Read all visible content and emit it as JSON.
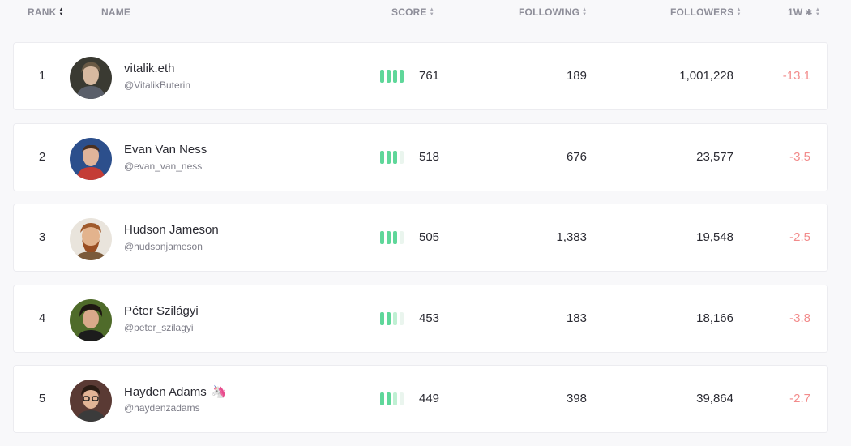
{
  "header": {
    "rank": "RANK",
    "name": "NAME",
    "score": "SCORE",
    "following": "FOLLOWING",
    "followers": "FOLLOWERS",
    "week": "1W",
    "star_glyph": "✱"
  },
  "colors": {
    "score_bar_on": "#5fd79a",
    "score_bar_off": "#eaf5ee",
    "negative_change": "#f28b8b"
  },
  "rows": [
    {
      "rank": "1",
      "name": "vitalik.eth",
      "handle": "@VitalikButerin",
      "score": "761",
      "score_level": 4,
      "following": "189",
      "followers": "1,001,228",
      "change": "-13.1",
      "emoji": ""
    },
    {
      "rank": "2",
      "name": "Evan Van Ness",
      "handle": "@evan_van_ness",
      "score": "518",
      "score_level": 3,
      "following": "676",
      "followers": "23,577",
      "change": "-3.5",
      "emoji": ""
    },
    {
      "rank": "3",
      "name": "Hudson Jameson",
      "handle": "@hudsonjameson",
      "score": "505",
      "score_level": 3,
      "following": "1,383",
      "followers": "19,548",
      "change": "-2.5",
      "emoji": ""
    },
    {
      "rank": "4",
      "name": "Péter Szilágyi",
      "handle": "@peter_szilagyi",
      "score": "453",
      "score_level": 2.5,
      "following": "183",
      "followers": "18,166",
      "change": "-3.8",
      "emoji": ""
    },
    {
      "rank": "5",
      "name": "Hayden Adams",
      "handle": "@haydenzadams",
      "score": "449",
      "score_level": 2.5,
      "following": "398",
      "followers": "39,864",
      "change": "-2.7",
      "emoji": "🦄"
    }
  ]
}
